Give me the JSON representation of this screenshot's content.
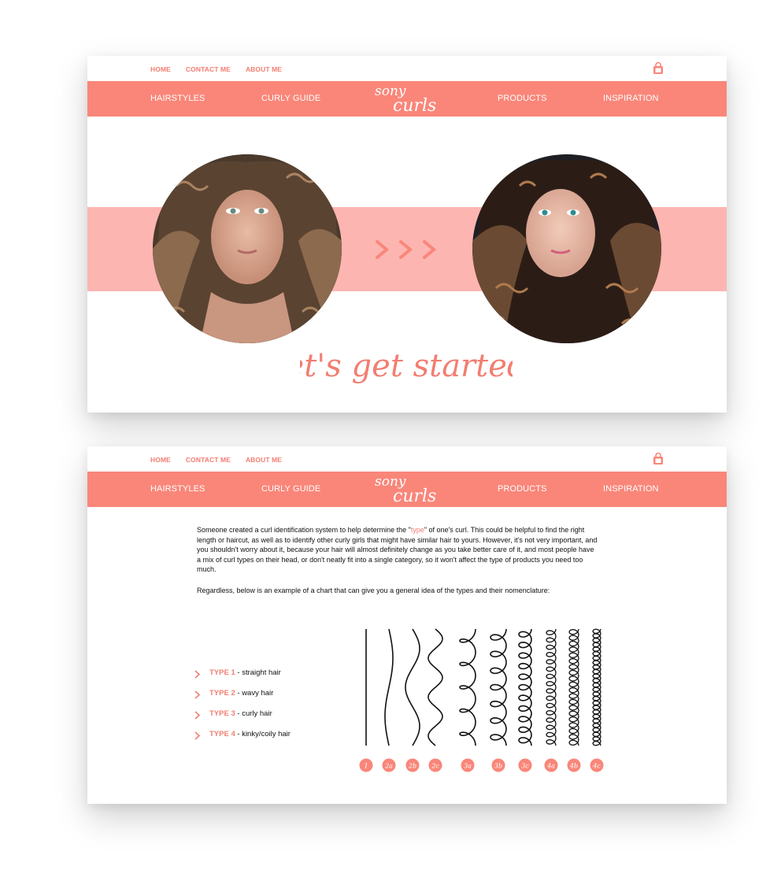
{
  "colors": {
    "accent": "#f98679",
    "accent_text": "#f27e72",
    "band": "#fdb5b1"
  },
  "header": {
    "top_links": [
      "HOME",
      "CONTACT ME",
      "ABOUT ME"
    ],
    "nav": [
      "HAIRSTYLES",
      "CURLY GUIDE",
      "PRODUCTS",
      "INSPIRATION"
    ],
    "logo_line1": "sony",
    "logo_line2": "curls",
    "cart_icon": "shopping-bag-icon"
  },
  "hero": {
    "tagline": "let's get started.",
    "arrows": ">>>"
  },
  "guide": {
    "p1_before": "Someone created a curl identification system to help determine the \"",
    "p1_highlight": "type",
    "p1_after": "\" of one's curl. This could be helpful to find the right length or haircut, as well as to identify other curly girls that might have similar hair to yours. However, it's not very important, and you shouldn't worry about it, because your hair will almost definitely change as you take better care of it, and most people have a mix of curl types on their head, or don't neatly fit into a single category, so it won't affect the type of products you need too much.",
    "p2": "Regardless, below is an example of a chart that can give you a general idea of the types and their nomenclature:",
    "types": [
      {
        "name": "TYPE 1",
        "desc": " - straight hair"
      },
      {
        "name": "TYPE 2",
        "desc": " - wavy hair"
      },
      {
        "name": "TYPE 3",
        "desc": " - curly hair"
      },
      {
        "name": "TYPE 4",
        "desc": " - kinky/coily hair"
      }
    ],
    "chart_labels": [
      "1",
      "2a",
      "2b",
      "2c",
      "3a",
      "3b",
      "3c",
      "4a",
      "4b",
      "4c"
    ]
  }
}
